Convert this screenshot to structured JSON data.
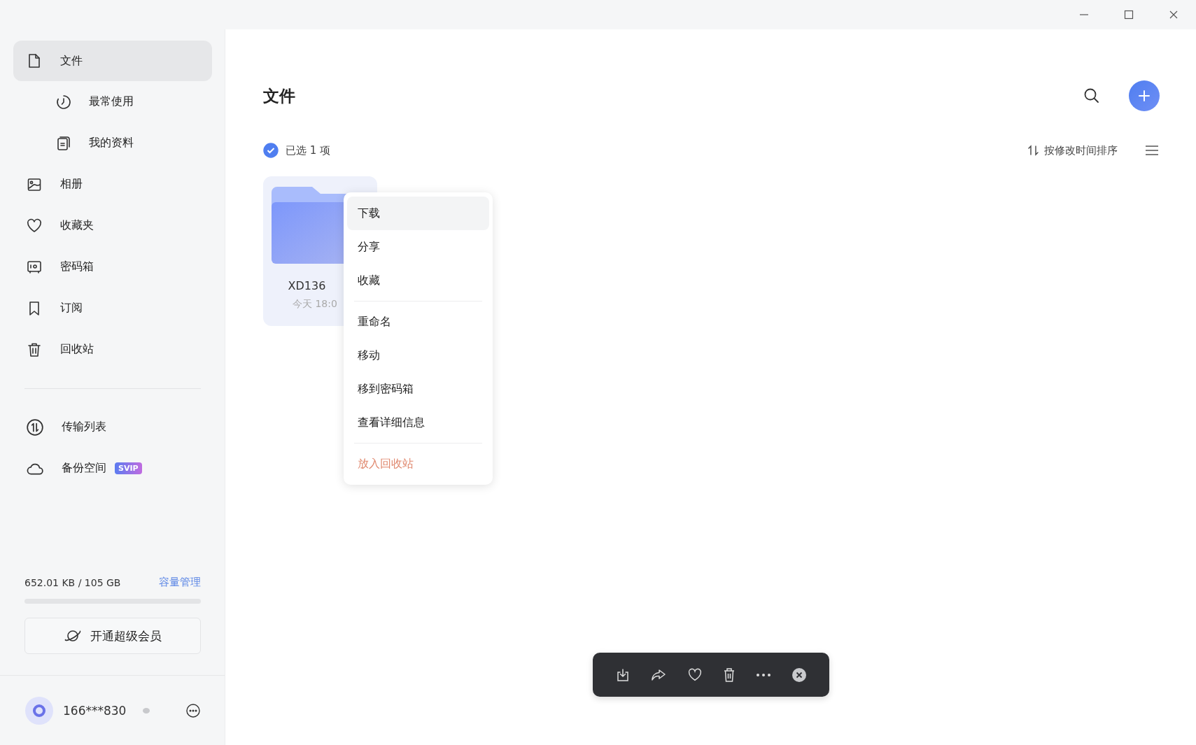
{
  "sidebar": {
    "nav": [
      {
        "label": "文件",
        "kind": "file",
        "selected": true,
        "children": [
          {
            "label": "最常使用",
            "kind": "clock",
            "selected": false
          },
          {
            "label": "我的资料",
            "kind": "notes",
            "selected": false
          }
        ]
      },
      {
        "label": "相册",
        "kind": "photo",
        "selected": false
      },
      {
        "label": "收藏夹",
        "kind": "heart",
        "selected": false
      },
      {
        "label": "密码箱",
        "kind": "safe",
        "selected": false
      },
      {
        "label": "订阅",
        "kind": "bookmark",
        "selected": false
      },
      {
        "label": "回收站",
        "kind": "trash",
        "selected": false
      }
    ],
    "tools": [
      {
        "label": "传输列表",
        "kind": "transfer",
        "selected": false
      },
      {
        "label": "备份空间",
        "kind": "cloud",
        "selected": false,
        "badge": "SVIP"
      }
    ],
    "storage": {
      "usage": "652.01 KB / 105 GB",
      "link": "容量管理"
    },
    "vip_button": "开通超级会员",
    "user": {
      "name": "166***830"
    }
  },
  "main": {
    "title": "文件",
    "selection": {
      "text": "已选 1 项",
      "checked": true
    },
    "sort": "按修改时间排序",
    "files": [
      {
        "name": "XD136",
        "date": "今天 18:0",
        "selected": true
      }
    ],
    "context_menu": {
      "groups": [
        [
          {
            "label": "下载",
            "kind": "normal",
            "highlighted": true
          },
          {
            "label": "分享",
            "kind": "normal",
            "highlighted": false
          },
          {
            "label": "收藏",
            "kind": "normal",
            "highlighted": false
          }
        ],
        [
          {
            "label": "重命名",
            "kind": "normal",
            "highlighted": false
          },
          {
            "label": "移动",
            "kind": "normal",
            "highlighted": false
          },
          {
            "label": "移到密码箱",
            "kind": "normal",
            "highlighted": false
          },
          {
            "label": "查看详细信息",
            "kind": "normal",
            "highlighted": false
          }
        ],
        [
          {
            "label": "放入回收站",
            "kind": "danger",
            "highlighted": false
          }
        ]
      ]
    }
  }
}
